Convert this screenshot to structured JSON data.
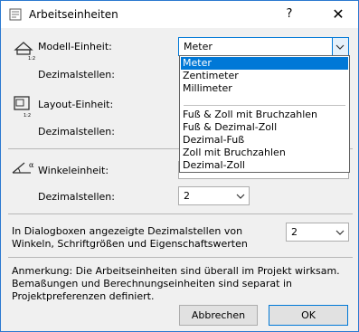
{
  "window": {
    "title": "Arbeitseinheiten",
    "help_glyph": "?",
    "close_glyph": "✕"
  },
  "model": {
    "label": "Modell-Einheit:",
    "value": "Meter",
    "decimals_label": "Dezimalstellen:"
  },
  "layout": {
    "label": "Layout-Einheit:",
    "decimals_label": "Dezimalstellen:"
  },
  "angle": {
    "label": "Winkeleinheit:",
    "decimals_label": "Dezimalstellen:",
    "decimals_value": "2"
  },
  "dropdown": {
    "items": [
      "Meter",
      "Zentimeter",
      "Millimeter",
      "Fuß & Zoll mit Bruchzahlen",
      "Fuß & Dezimal-Zoll",
      "Dezimal-Fuß",
      "Zoll mit Bruchzahlen",
      "Dezimal-Zoll"
    ],
    "selected": "Meter"
  },
  "dialog_decimals": {
    "label_line1": "In Dialogboxen angezeigte Dezimalstellen von",
    "label_line2": "Winkeln, Schriftgrößen und Eigenschaftswerten",
    "value": "2"
  },
  "note": {
    "line1": "Anmerkung: Die Arbeitseinheiten sind überall im Projekt wirksam.",
    "line2": "Bemaßungen und Berechnungseinheiten sind separat in",
    "line3": "Projektpreferenzen definiert."
  },
  "buttons": {
    "cancel": "Abbrechen",
    "ok": "OK"
  },
  "icons": {
    "app": "settings-icon",
    "model": "model-unit-icon",
    "layout": "layout-unit-icon",
    "angle": "angle-icon",
    "chevron": "chevron-down-icon"
  },
  "colors": {
    "selection": "#0078d7",
    "window_border": "#2b79d0"
  }
}
